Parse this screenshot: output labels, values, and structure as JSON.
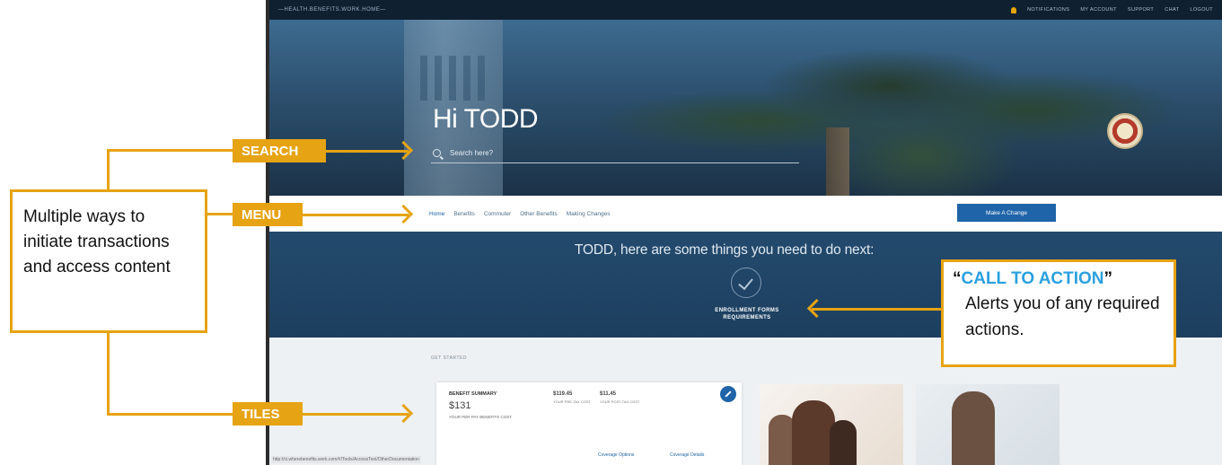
{
  "topbar": {
    "url": "—HEALTH.BENEFITS.WORK.HOME—",
    "links": [
      "NOTIFICATIONS",
      "MY ACCOUNT",
      "SUPPORT",
      "CHAT",
      "LOGOUT"
    ]
  },
  "hero": {
    "greeting": "Hi TODD",
    "search_placeholder": "Search here?"
  },
  "nav": {
    "items": [
      "Home",
      "Benefits",
      "Commuter",
      "Other Benefits",
      "Making Changes"
    ],
    "cta_button": "Make A Change"
  },
  "todo": {
    "title": "TODD, here are some things you need to do next:",
    "item": "ENROLLMENT FORMS REQUIREMENTS"
  },
  "tiles": {
    "section_label": "GET STARTED",
    "benefit_summary": {
      "label": "BENEFIT SUMMARY",
      "amount": "$131",
      "sub": "YOUR PER PAY BENEFITS COST",
      "pre_tax": "$119.45",
      "pre_tax_label": "YOUR PRE-TAX COST",
      "post_tax": "$11.45",
      "post_tax_label": "YOUR POST-TAX COST",
      "link1": "Coverage Options",
      "link2": "Coverage Details"
    }
  },
  "status_url": "http://ci.wherebenefits.work.com/#/Tools/AccessTool/OtherDocumentation",
  "annotations": {
    "search": "SEARCH",
    "menu": "MENU",
    "tiles": "TILES",
    "note_text": "Multiple ways to initiate transactions and access content",
    "cta_quote_open": "“",
    "cta_head": "CALL TO ACTION",
    "cta_quote_close": "”",
    "cta_desc": "Alerts you of any required actions."
  },
  "colors": {
    "annotation": "#e6a313",
    "cta_highlight": "#2aa0e0",
    "button": "#1f64a8",
    "topbar": "#0f2031"
  }
}
